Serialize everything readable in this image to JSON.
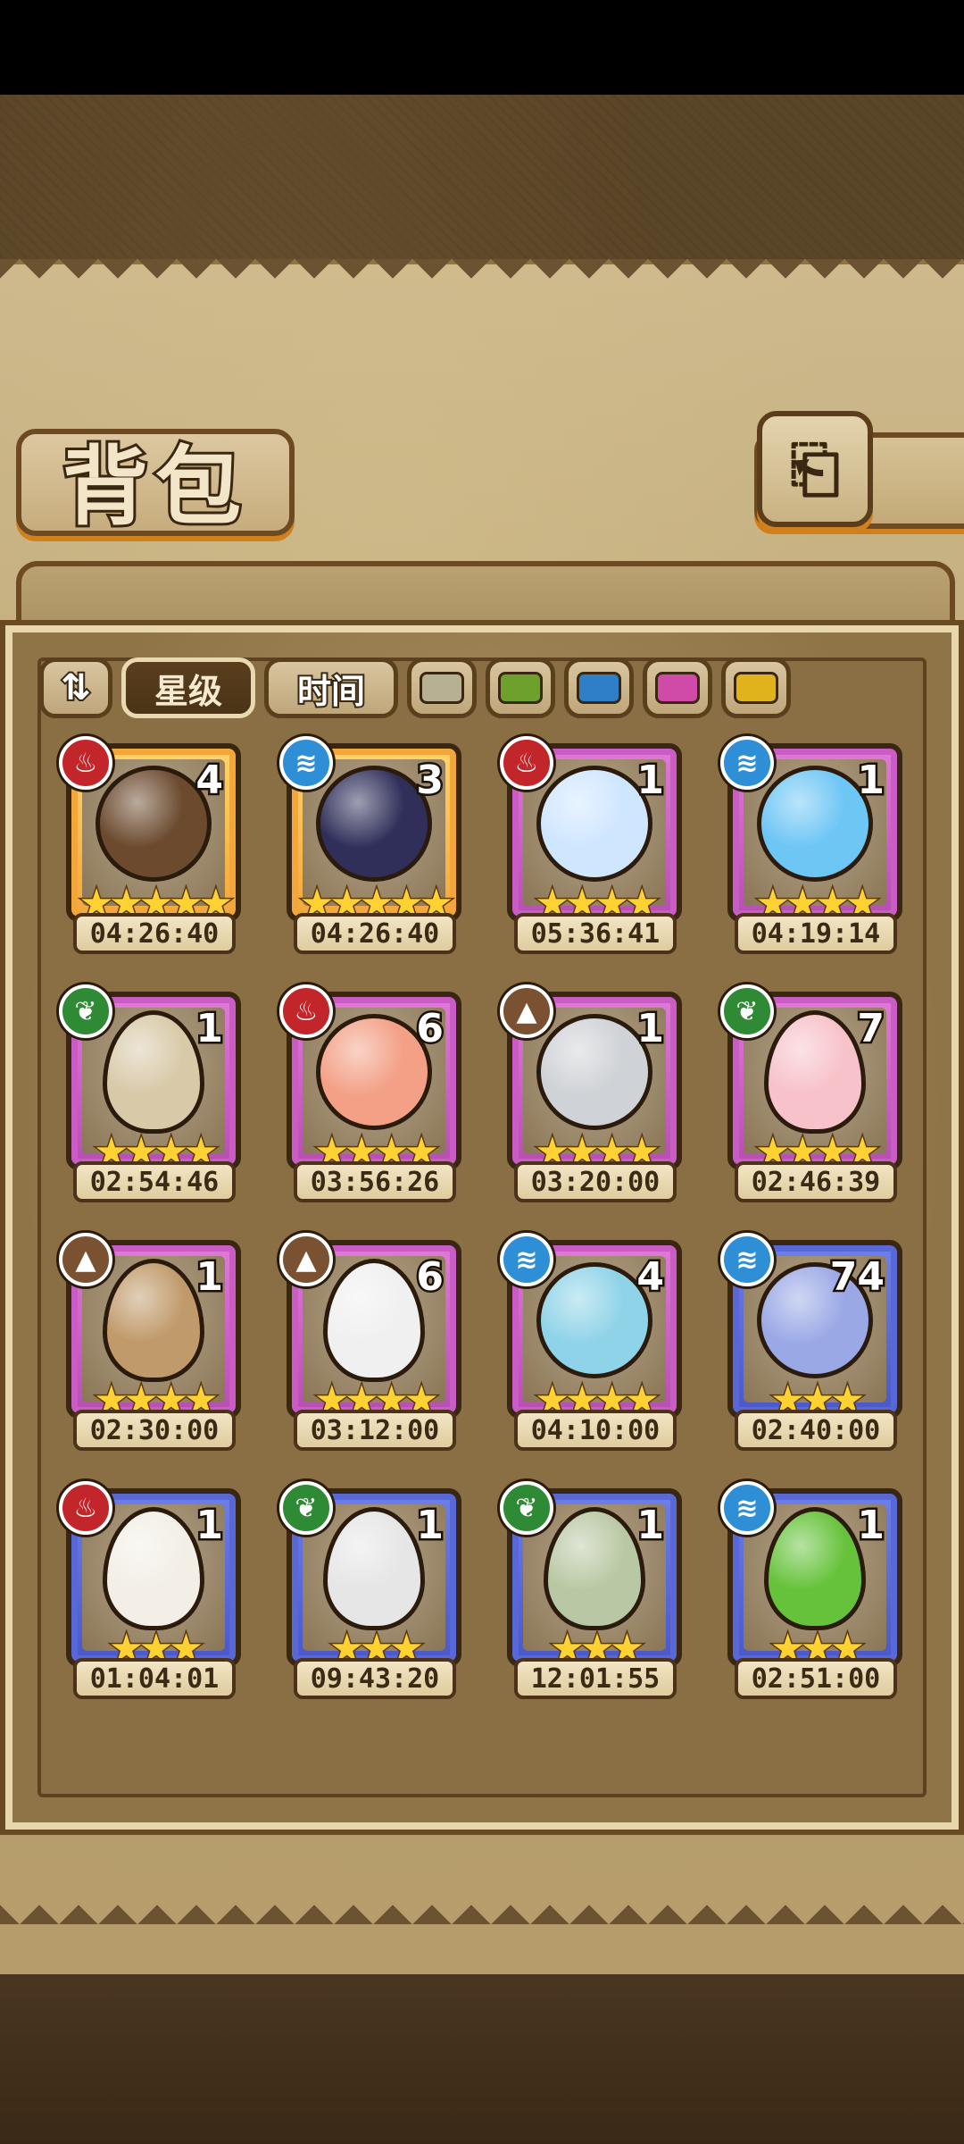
{
  "header": {
    "title": "背包",
    "back_icon": "⎗"
  },
  "filters": {
    "sort_icon": "⇅",
    "star_label": "星级",
    "time_label": "时间",
    "colors": [
      "#b8b093",
      "#6ea12b",
      "#2f7fc8",
      "#d04aa7",
      "#e0b21c"
    ]
  },
  "items": [
    {
      "rarity": "r5",
      "element": "fire",
      "count": "4",
      "stars": "★★★★★",
      "timer": "04:26:40",
      "art": "bow-quiver",
      "art_color": "#6b4a2e",
      "egg": false
    },
    {
      "rarity": "r5",
      "element": "water",
      "count": "3",
      "stars": "★★★★★",
      "timer": "04:26:40",
      "art": "feather-cloak",
      "art_color": "#2f2f5a",
      "egg": false
    },
    {
      "rarity": "r4",
      "element": "fire",
      "count": "1",
      "stars": "★★★★",
      "timer": "05:36:41",
      "art": "ice-shards",
      "art_color": "#cfe6ff",
      "egg": false
    },
    {
      "rarity": "r4",
      "element": "water",
      "count": "1",
      "stars": "★★★★",
      "timer": "04:19:14",
      "art": "water-spirit",
      "art_color": "#6ec6f5",
      "egg": false
    },
    {
      "rarity": "r4",
      "element": "grass",
      "count": "1",
      "stars": "★★★★",
      "timer": "02:54:46",
      "art": "leaf-egg",
      "art_color": "#d8c9a8",
      "egg": true
    },
    {
      "rarity": "r4",
      "element": "fire",
      "count": "6",
      "stars": "★★★★",
      "timer": "03:56:26",
      "art": "kimono-egg",
      "art_color": "#f3a086",
      "egg": false
    },
    {
      "rarity": "r4",
      "element": "earth",
      "count": "1",
      "stars": "★★★★",
      "timer": "03:20:00",
      "art": "sword",
      "art_color": "#cfd2d6",
      "egg": false
    },
    {
      "rarity": "r4",
      "element": "grass",
      "count": "7",
      "stars": "★★★★",
      "timer": "02:46:39",
      "art": "pink-egg",
      "art_color": "#f7c2c9",
      "egg": true
    },
    {
      "rarity": "r4",
      "element": "earth",
      "count": "1",
      "stars": "★★★★",
      "timer": "02:30:00",
      "art": "furry-egg",
      "art_color": "#c09a6a",
      "egg": true
    },
    {
      "rarity": "r4",
      "element": "earth",
      "count": "6",
      "stars": "★★★★",
      "timer": "03:12:00",
      "art": "cracked-egg",
      "art_color": "#f0f0f0",
      "egg": true
    },
    {
      "rarity": "r4",
      "element": "water",
      "count": "4",
      "stars": "★★★★",
      "timer": "04:10:00",
      "art": "blue-slime",
      "art_color": "#8fd3e8",
      "egg": false
    },
    {
      "rarity": "r3",
      "element": "water",
      "count": "74",
      "stars": "★★★",
      "timer": "02:40:00",
      "art": "crystal",
      "art_color": "#9aa8e6",
      "egg": false
    },
    {
      "rarity": "r3",
      "element": "fire",
      "count": "1",
      "stars": "★★★",
      "timer": "01:04:01",
      "art": "fire-egg",
      "art_color": "#f3efe6",
      "egg": true
    },
    {
      "rarity": "r3",
      "element": "grass",
      "count": "1",
      "stars": "★★★",
      "timer": "09:43:20",
      "art": "rainbow-egg",
      "art_color": "#e6e6e6",
      "egg": true
    },
    {
      "rarity": "r3",
      "element": "grass",
      "count": "1",
      "stars": "★★★",
      "timer": "12:01:55",
      "art": "leaf-pod",
      "art_color": "#b9c8a4",
      "egg": true
    },
    {
      "rarity": "r3",
      "element": "water",
      "count": "1",
      "stars": "★★★",
      "timer": "02:51:00",
      "art": "green-egg",
      "art_color": "#66c23a",
      "egg": true
    }
  ],
  "element_glyphs": {
    "fire": "♨",
    "water": "≋",
    "earth": "▲",
    "grass": "❦"
  }
}
